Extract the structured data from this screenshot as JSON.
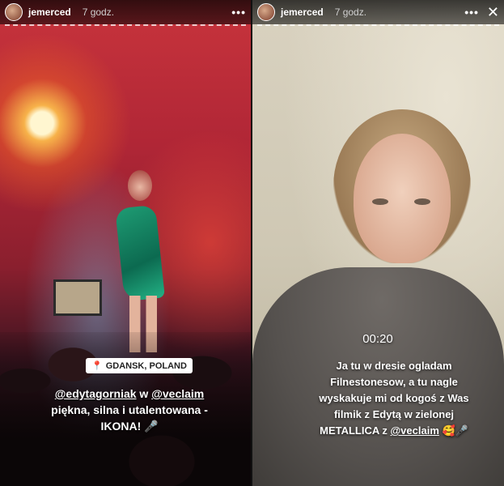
{
  "stories": [
    {
      "username": "jemerced",
      "time": "7 godz.",
      "more_icon": "•••",
      "location": "GDANSK, POLAND",
      "caption": {
        "line1_mention1": "@edytagorniak",
        "line1_mid": " w ",
        "line1_mention2": "@veclaim",
        "line2": "piękna, silna i utalentowana -",
        "line3": "IKONA! 🎤"
      }
    },
    {
      "username": "jemerced",
      "time": "7 godz.",
      "more_icon": "•••",
      "close_icon": "✕",
      "timer": "00:20",
      "caption": {
        "line1": "Ja tu w dresie ogladam",
        "line2": "Filnestonesow, a tu nagle",
        "line3": "wyskakuje mi od kogoś z Was",
        "line4": "filmik z Edytą w zielonej",
        "line5_pre": "METALLICA z ",
        "line5_mention": "@veclaim",
        "line5_post": " 🥰🎤"
      }
    }
  ],
  "colors": {
    "header_bg": "#000000",
    "text": "#ffffff",
    "time_text": "#cfcfcf"
  }
}
